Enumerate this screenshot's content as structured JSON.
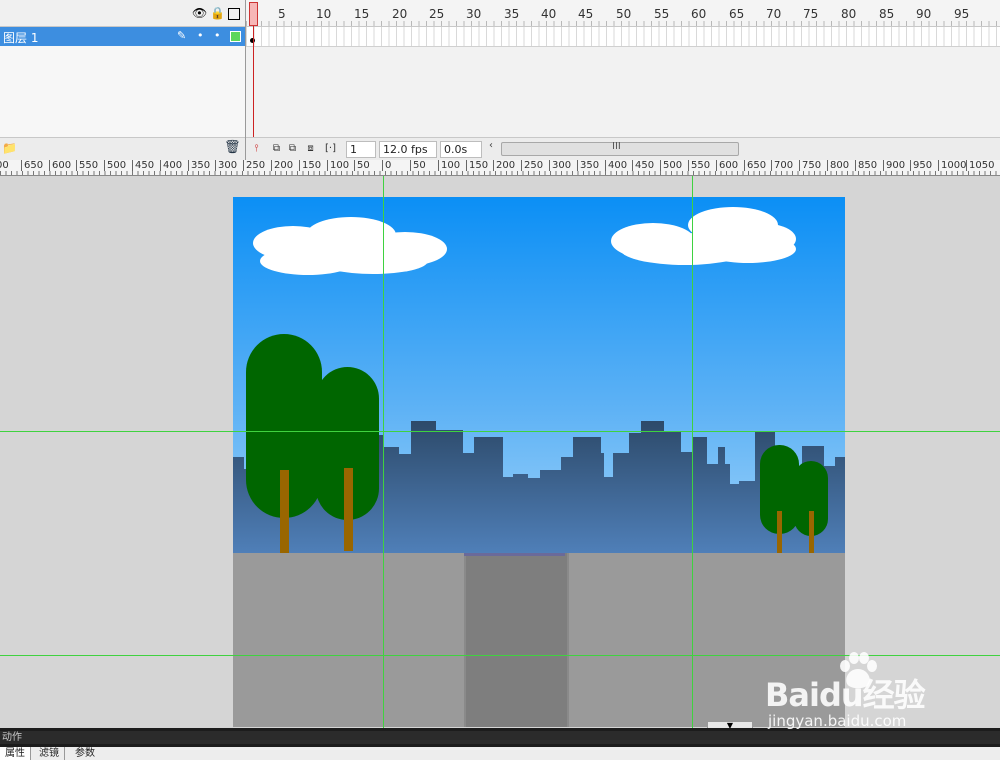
{
  "timeline": {
    "header_icons": [
      "eye-icon",
      "lock-icon",
      "outline-icon"
    ],
    "frame_numbers": [
      "5",
      "10",
      "15",
      "20",
      "25",
      "30",
      "35",
      "40",
      "45",
      "50",
      "55",
      "60",
      "65",
      "70",
      "75",
      "80",
      "85",
      "90",
      "95"
    ],
    "layer": {
      "name": "图层 1",
      "icons": [
        "pencil-icon",
        "dot",
        "dot"
      ],
      "color": "#5cd65c"
    },
    "status": {
      "current_frame": "1",
      "fps": "12.0 fps",
      "elapsed": "0.0s",
      "scroll_grip": "III",
      "scroll_arrow": "‹"
    }
  },
  "ruler": {
    "labels": [
      "00",
      "650",
      "600",
      "550",
      "500",
      "450",
      "400",
      "350",
      "300",
      "250",
      "200",
      "150",
      "100",
      "50",
      "0",
      "50",
      "100",
      "150",
      "200",
      "250",
      "300",
      "350",
      "400",
      "450",
      "500",
      "550",
      "600",
      "650",
      "700",
      "750",
      "800",
      "850",
      "900",
      "950",
      "1000",
      "1050"
    ]
  },
  "scene": {
    "sky_colors": [
      "#0b8ff5",
      "#aedbfb"
    ],
    "ground_color": "#9a9a9a",
    "road_color": "#7e7e7e",
    "tree_color": "#006600",
    "trunk_color": "#996600",
    "building_color": "#2d4a6a"
  },
  "panels": {
    "actions_label": "动作",
    "tabs": [
      "属性",
      "滤镜",
      "参数"
    ]
  },
  "watermark": {
    "logo": "Baidu经验",
    "url": "jingyan.baidu.com"
  }
}
